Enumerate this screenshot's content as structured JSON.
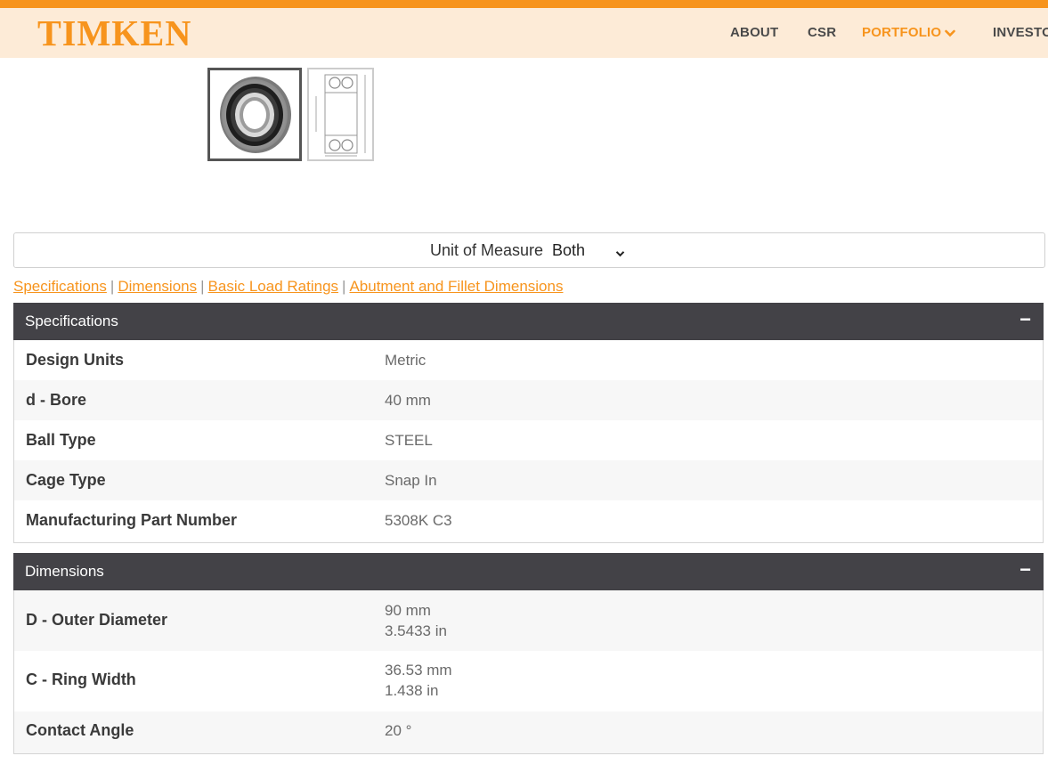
{
  "brand": {
    "logo_text": "TIMKEN",
    "accent": "#f7941d",
    "header_bg": "#fdebd7",
    "panel_head_bg": "#434247"
  },
  "nav": {
    "items": [
      {
        "label": "ABOUT"
      },
      {
        "label": "CSR"
      },
      {
        "label": "PORTFOLIO",
        "active": true
      },
      {
        "label": "INVESTO"
      }
    ]
  },
  "gallery": {
    "thumbnails": [
      {
        "icon": "bearing-photo-icon",
        "selected": true
      },
      {
        "icon": "bearing-drawing-icon",
        "selected": false
      }
    ]
  },
  "unit_of_measure": {
    "label": "Unit of Measure",
    "selected": "Both"
  },
  "section_links": [
    "Specifications",
    "Dimensions",
    "Basic Load Ratings",
    "Abutment and Fillet Dimensions"
  ],
  "specifications": {
    "title": "Specifications",
    "toggle": "−",
    "rows": [
      {
        "label": "Design Units",
        "value": "Metric"
      },
      {
        "label": "d - Bore",
        "value": "40 mm"
      },
      {
        "label": "Ball Type",
        "value": "STEEL"
      },
      {
        "label": "Cage Type",
        "value": "Snap In"
      },
      {
        "label": "Manufacturing Part Number",
        "value": "5308K C3"
      }
    ]
  },
  "dimensions": {
    "title": "Dimensions",
    "toggle": "−",
    "rows": [
      {
        "label": "D - Outer Diameter",
        "value_metric": "90 mm",
        "value_imperial": "3.5433 in"
      },
      {
        "label": "C - Ring Width",
        "value_metric": "36.53 mm",
        "value_imperial": "1.438 in"
      },
      {
        "label": "Contact Angle",
        "value_metric": "20 °"
      }
    ]
  }
}
